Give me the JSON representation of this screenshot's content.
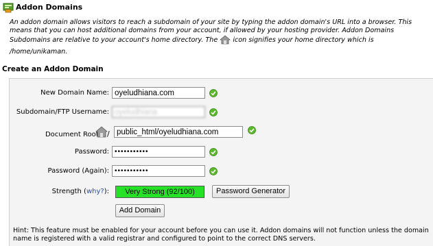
{
  "header": {
    "title": "Addon Domains",
    "icon": "addon-domains-icon",
    "description_part1": "An addon domain allows visitors to reach a subdomain of your site by typing the addon domain's URL into a browser. This means that you can host additional domains from your account, if allowed by your hosting provider. Addon Domains Subdomains are relative to your account's home directory. The ",
    "description_part2": " icon signifies your home directory which is",
    "home_path": "/home/unikaman."
  },
  "section": {
    "title": "Create an Addon Domain"
  },
  "form": {
    "new_domain_label": "New Domain Name:",
    "new_domain_value": "oyeludhiana.com",
    "subdomain_label": "Subdomain/FTP Username:",
    "subdomain_value": "oyeludhiana",
    "docroot_label": "Document Root:",
    "docroot_slash": "/",
    "docroot_value": "public_html/oyeludhiana.com",
    "password_label": "Password:",
    "password_value": "•••••••••••",
    "password_again_label": "Password (Again):",
    "password_again_value": "•••••••••••",
    "strength_label_prefix": "Strength (",
    "strength_why": "why?",
    "strength_label_suffix": "):",
    "strength_value": "Very Strong (92/100)",
    "strength_color": "#26e226",
    "password_generator_label": "Password Generator",
    "add_domain_label": "Add Domain"
  },
  "hint": "Hint: This feature must be enabled for your account before you can use it. Addon domains will not function unless the domain name is registered with a valid registrar and configured to point to the correct DNS servers."
}
